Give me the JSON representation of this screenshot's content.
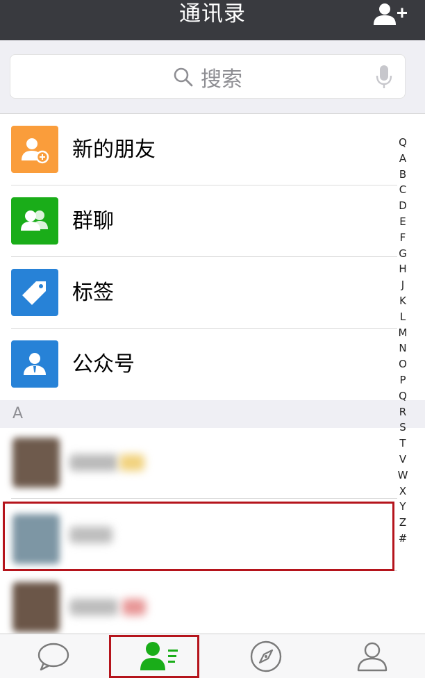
{
  "header": {
    "title": "通讯录"
  },
  "search": {
    "placeholder": "搜索"
  },
  "menu_items": [
    {
      "label": "新的朋友",
      "icon": "add-friend-icon",
      "color": "#fa9d3b"
    },
    {
      "label": "群聊",
      "icon": "group-chat-icon",
      "color": "#1aad19"
    },
    {
      "label": "标签",
      "icon": "tag-icon",
      "color": "#2782d7"
    },
    {
      "label": "公众号",
      "icon": "official-account-icon",
      "color": "#2782d7"
    }
  ],
  "section": {
    "letter": "A"
  },
  "index_letters": [
    "Q",
    "A",
    "B",
    "C",
    "D",
    "E",
    "F",
    "G",
    "H",
    "J",
    "K",
    "L",
    "M",
    "N",
    "O",
    "P",
    "Q",
    "R",
    "S",
    "T",
    "V",
    "W",
    "X",
    "Y",
    "Z",
    "#"
  ],
  "tabbar": {
    "tabs": [
      {
        "icon": "chat-bubble-icon",
        "active": false
      },
      {
        "icon": "contacts-icon",
        "active": true
      },
      {
        "icon": "compass-icon",
        "active": false
      },
      {
        "icon": "profile-icon",
        "active": false
      }
    ],
    "active_color": "#1aad19"
  },
  "colors": {
    "navbar": "#393a3f",
    "highlight": "#b5141c"
  }
}
